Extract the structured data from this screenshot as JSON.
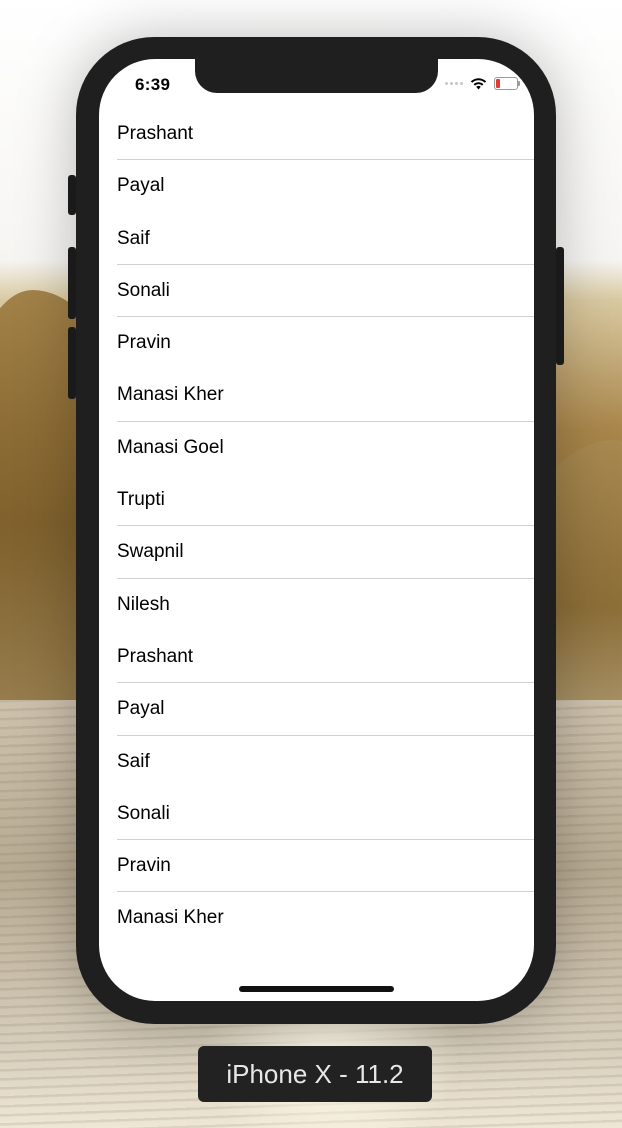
{
  "status_bar": {
    "time": "6:39",
    "icons": [
      "signal-dots-icon",
      "wifi-icon",
      "battery-low-icon"
    ],
    "battery_color": "#e53935"
  },
  "list": {
    "items": [
      {
        "label": "Prashant"
      },
      {
        "label": "Payal"
      },
      {
        "label": "Saif"
      },
      {
        "label": "Sonali"
      },
      {
        "label": "Pravin"
      },
      {
        "label": "Manasi Kher"
      },
      {
        "label": "Manasi Goel"
      },
      {
        "label": "Trupti"
      },
      {
        "label": "Swapnil"
      },
      {
        "label": "Nilesh"
      },
      {
        "label": "Prashant"
      },
      {
        "label": "Payal"
      },
      {
        "label": "Saif"
      },
      {
        "label": "Sonali"
      },
      {
        "label": "Pravin"
      },
      {
        "label": "Manasi Kher"
      }
    ]
  },
  "simulator": {
    "device_label": "iPhone X - 11.2"
  }
}
